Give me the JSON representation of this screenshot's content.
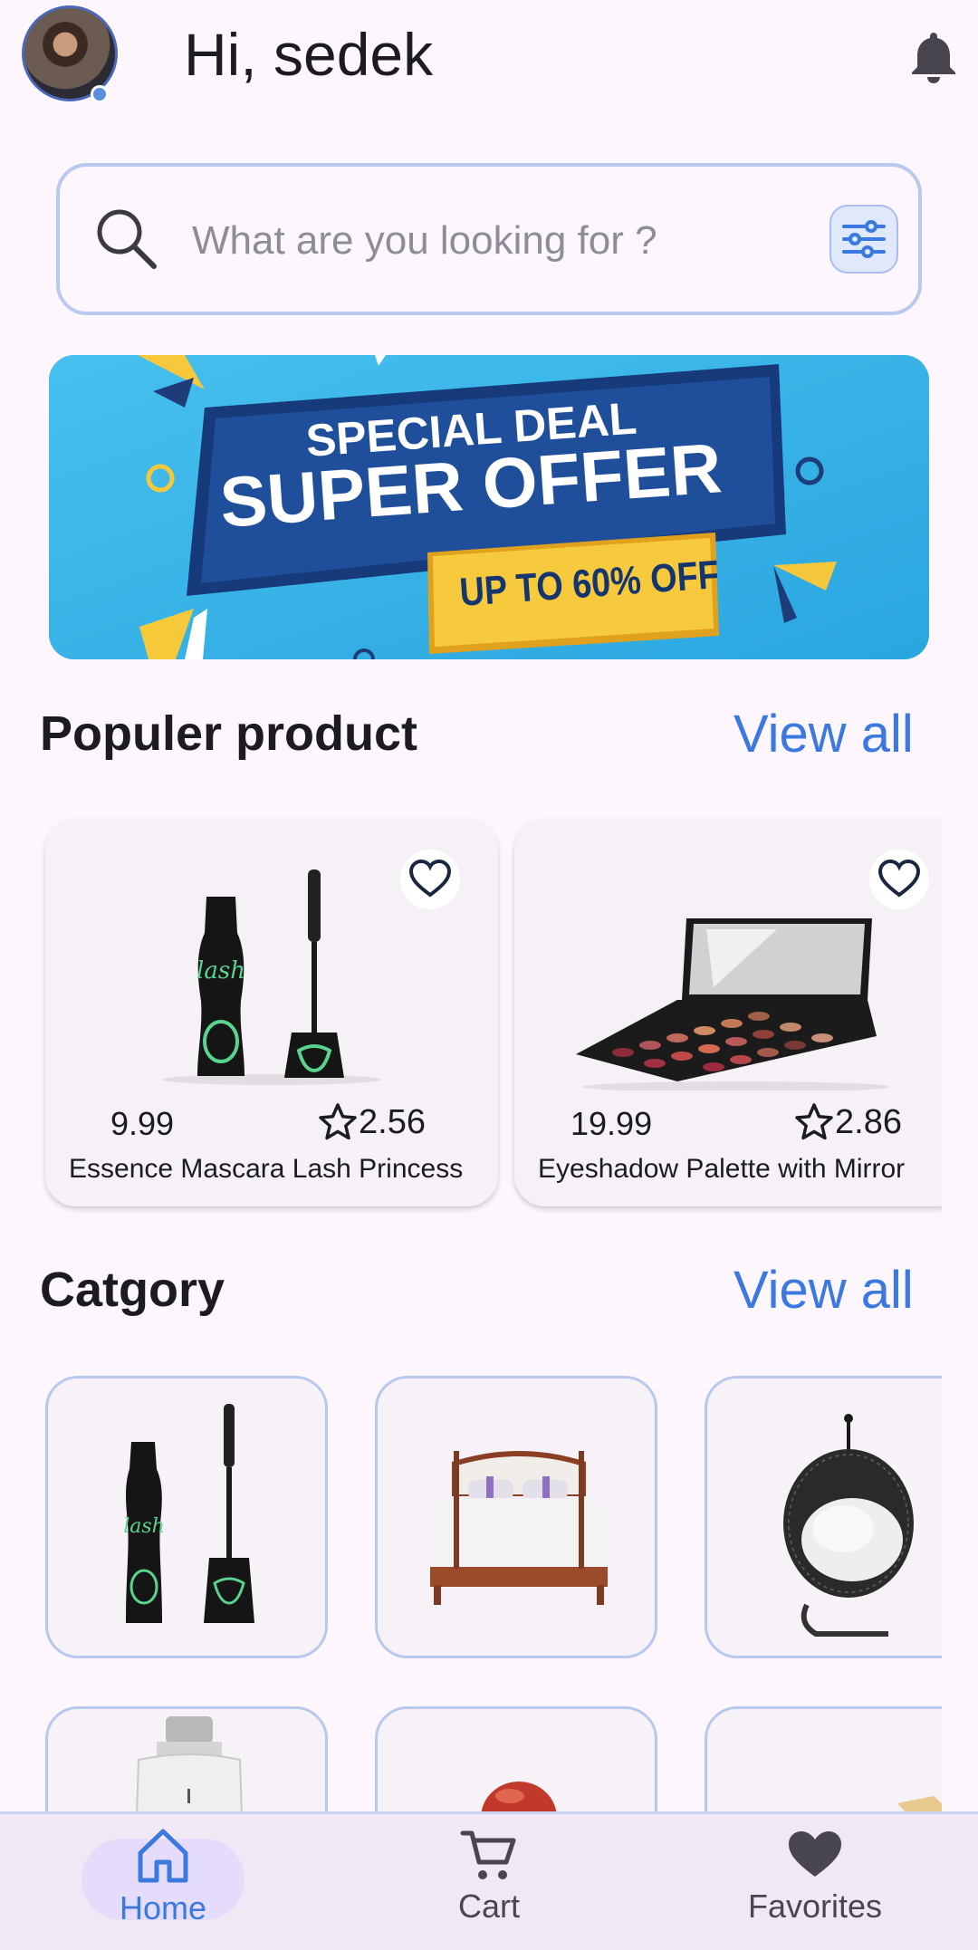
{
  "header": {
    "greeting": "Hi, sedek"
  },
  "search": {
    "placeholder": "What are you looking for ?"
  },
  "banner": {
    "line1": "SPECIAL DEAL",
    "line2": "SUPER OFFER",
    "line3": "UP TO 60% OFF"
  },
  "popular": {
    "title": "Populer product",
    "view_all": "View all",
    "products": [
      {
        "price": "9.99",
        "rating": "2.56",
        "name": "Essence Mascara Lash Princess"
      },
      {
        "price": "19.99",
        "rating": "2.86",
        "name": "Eyeshadow Palette with Mirror"
      }
    ]
  },
  "category": {
    "title": "Catgory",
    "view_all": "View all"
  },
  "nav": {
    "home": "Home",
    "cart": "Cart",
    "favorites": "Favorites"
  },
  "colors": {
    "accent": "#3b78e0",
    "background": "#fdf6fc",
    "nav_active": "#3b78e0",
    "nav_inactive": "#4a4650"
  }
}
